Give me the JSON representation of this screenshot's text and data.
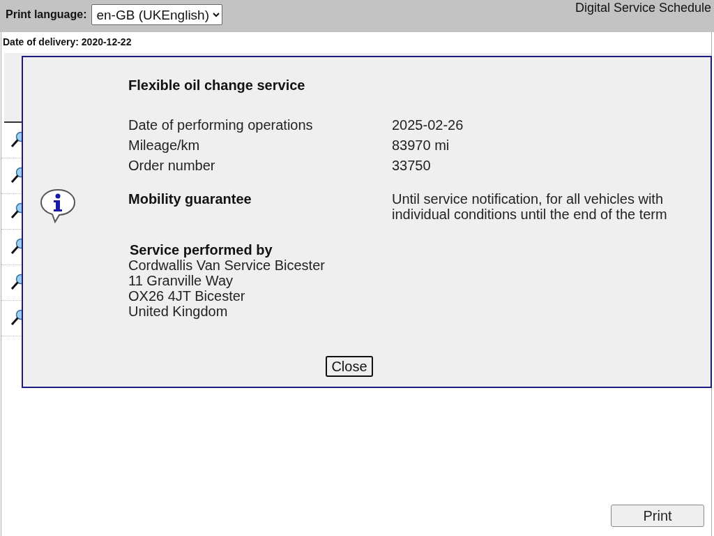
{
  "header": {
    "print_language_label": "Print language:",
    "language_select": "en-GB (UKEnglish)",
    "title": "Digital Service Schedule"
  },
  "date_of_delivery": "Date of delivery: 2020-12-22",
  "schedule_rows": [
    {
      "kind": "magnifier"
    },
    {
      "kind": "magnifier"
    },
    {
      "kind": "magnifier"
    },
    {
      "kind": "magnifier"
    },
    {
      "kind": "magnifier"
    },
    {
      "kind": "magnifier"
    }
  ],
  "dialog": {
    "title": "Flexible oil change service",
    "details": [
      {
        "label": "Date of performing operations",
        "value": "2025-02-26"
      },
      {
        "label": "Mileage/km",
        "value": "83970 mi"
      },
      {
        "label": "Order number",
        "value": "33750"
      }
    ],
    "guarantee": {
      "label": "Mobility guarantee",
      "value": "Until service notification, for all vehicles with individual conditions until the end of the term"
    },
    "performed_by": {
      "heading": "Service performed by",
      "lines": [
        "Cordwallis Van Service Bicester",
        "11 Granville Way",
        "OX26 4JT Bicester",
        "United Kingdom"
      ]
    },
    "close_button": "Close"
  },
  "print_button": "Print"
}
